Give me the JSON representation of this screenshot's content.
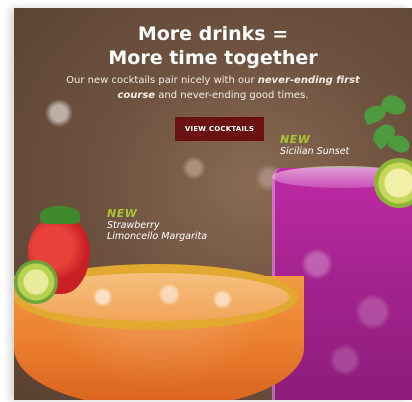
{
  "promo": {
    "headline_line1": "More drinks =",
    "headline_line2": "More time together",
    "subcopy_part1": "Our new cocktails pair nicely with our ",
    "subcopy_emph": "never-ending first course",
    "subcopy_part2": " and never-ending good times.",
    "cta_label": "VIEW COCKTAILS",
    "colors": {
      "cta_background": "#6b1111",
      "new_badge": "#a8c53a",
      "background": "#6e5240"
    }
  },
  "drinks": [
    {
      "badge": "NEW",
      "name_line1": "Sicilian Sunset",
      "name_line2": ""
    },
    {
      "badge": "NEW",
      "name_line1": "Strawberry",
      "name_line2": "Limoncello Margarita"
    }
  ]
}
